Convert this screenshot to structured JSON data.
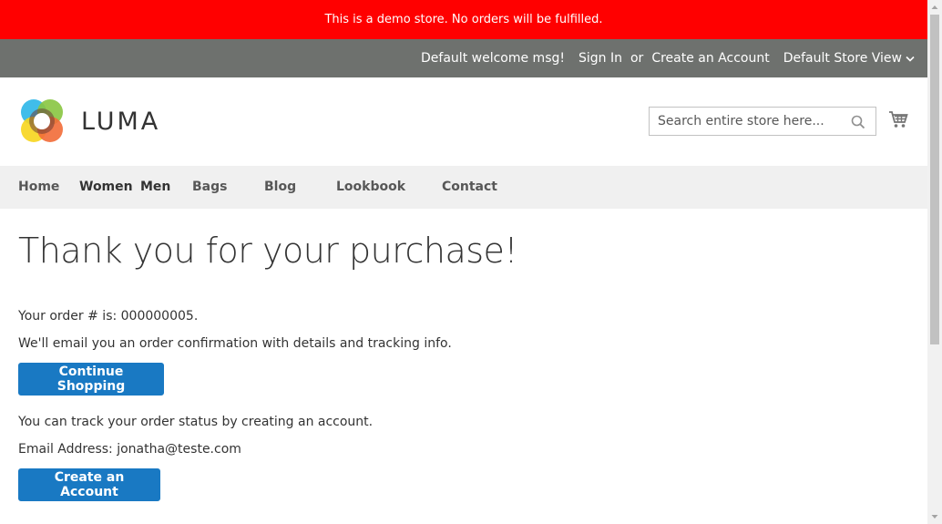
{
  "demo_notice": "This is a demo store. No orders will be fulfilled.",
  "header_links": {
    "welcome": "Default welcome msg!",
    "sign_in": "Sign In",
    "or": "or",
    "create_account": "Create an Account",
    "store_view": "Default Store View"
  },
  "logo": {
    "text": "LUMA"
  },
  "search": {
    "placeholder": "Search entire store here..."
  },
  "nav": {
    "items": [
      {
        "label": "Home"
      },
      {
        "label": "Women"
      },
      {
        "label": "Men"
      },
      {
        "label": "Bags"
      },
      {
        "label": "Blog"
      },
      {
        "label": "Lookbook"
      },
      {
        "label": "Contact"
      }
    ]
  },
  "page": {
    "title": "Thank you for your purchase!",
    "order_number_text": "Your order # is: 000000005.",
    "email_confirmation_text": "We'll email you an order confirmation with details and tracking info.",
    "continue_shopping_label": "Continue Shopping",
    "track_order_text": "You can track your order status by creating an account.",
    "email_address_text": "Email Address: jonatha@teste.com",
    "create_account_label": "Create an Account"
  },
  "colors": {
    "demo_notice_bg": "#ff0000",
    "header_bar_bg": "#6e716e",
    "nav_bg": "#f0f0f0",
    "primary_button": "#1979c3"
  }
}
